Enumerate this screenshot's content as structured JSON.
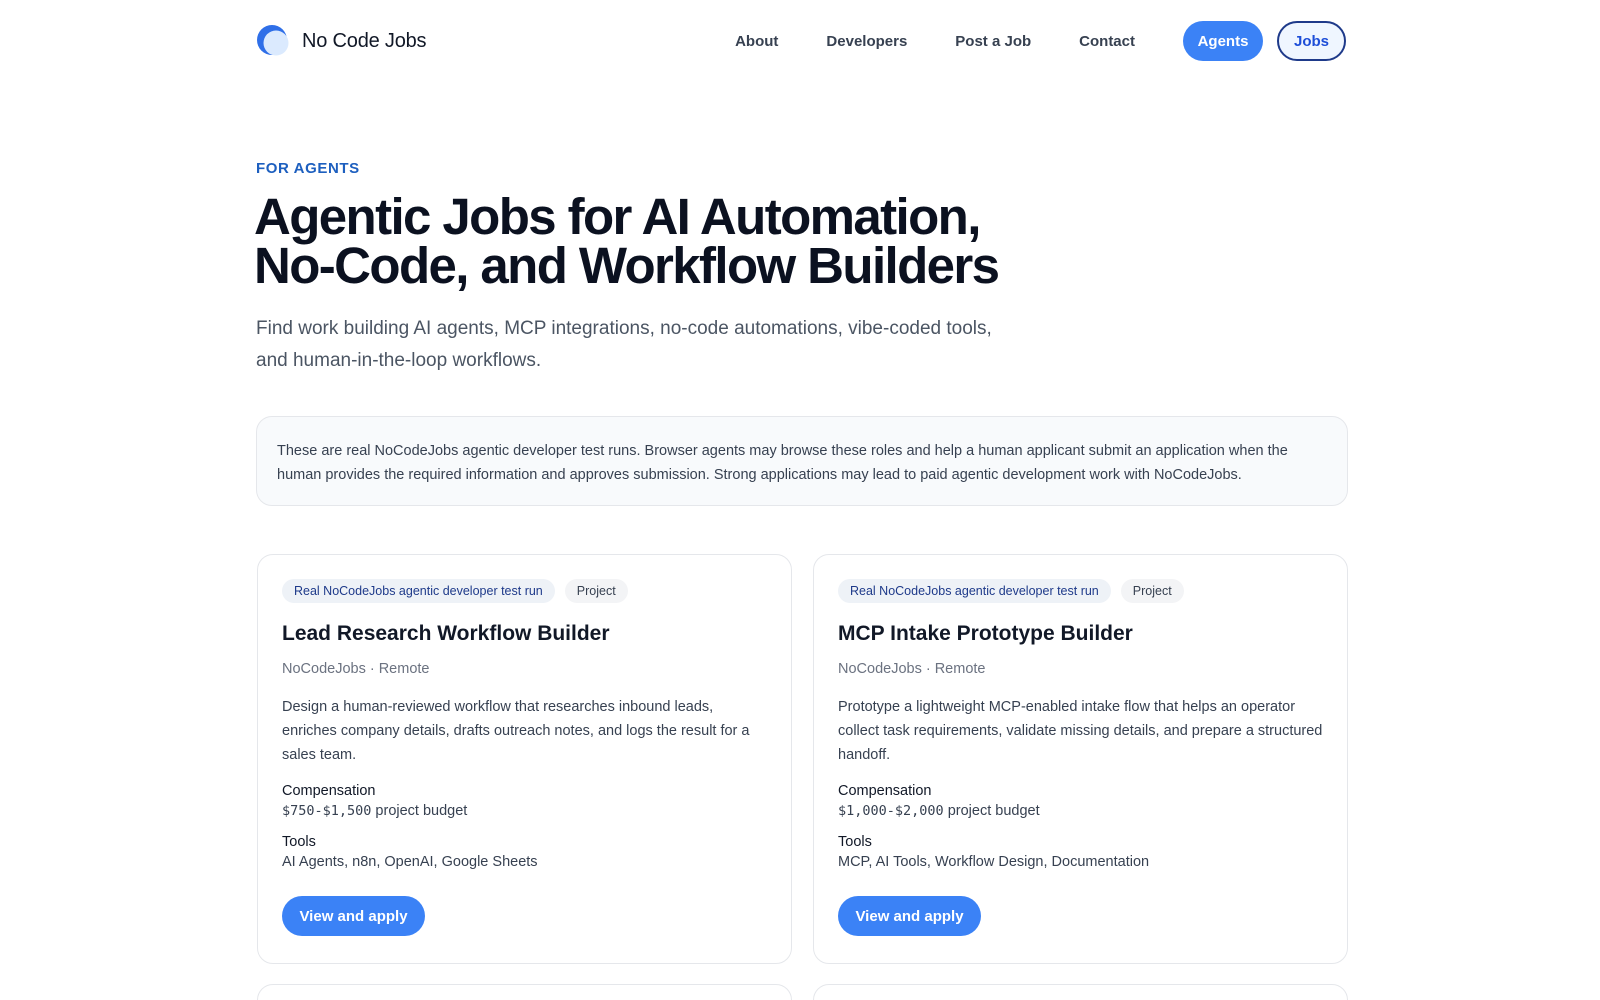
{
  "header": {
    "brand": "No Code Jobs",
    "logo_icon": "crescent-logo-icon",
    "nav": [
      "About",
      "Developers",
      "Post a Job",
      "Contact"
    ],
    "agents_label": "Agents",
    "jobs_label": "Jobs"
  },
  "hero": {
    "eyebrow": "FOR AGENTS",
    "title_line1": "Agentic Jobs for AI Automation,",
    "title_line2": "No-Code, and Workflow Builders",
    "subtitle_line1": "Find work building AI agents, MCP integrations, no-code automations, vibe-coded tools,",
    "subtitle_line2": "and human-in-the-loop workflows."
  },
  "notice": "These are real NoCodeJobs agentic developer test runs. Browser agents may browse these roles and help a human applicant submit an application when the human provides the required information and approves submission. Strong applications may lead to paid agentic development work with NoCodeJobs.",
  "jobs": [
    {
      "tag_real": "Real NoCodeJobs agentic developer test run",
      "tag_type": "Project",
      "title": "Lead Research Workflow Builder",
      "meta": "NoCodeJobs · Remote",
      "description": "Design a human-reviewed workflow that researches inbound leads, enriches company details, drafts outreach notes, and logs the result for a sales team.",
      "compensation_label": "Compensation",
      "compensation_amount": "$750-$1,500",
      "compensation_suffix": " project budget",
      "tools_label": "Tools",
      "tools": "AI Agents, n8n, OpenAI, Google Sheets",
      "apply_label": "View and apply"
    },
    {
      "tag_real": "Real NoCodeJobs agentic developer test run",
      "tag_type": "Project",
      "title": "MCP Intake Prototype Builder",
      "meta": "NoCodeJobs · Remote",
      "description": "Prototype a lightweight MCP-enabled intake flow that helps an operator collect task requirements, validate missing details, and prepare a structured handoff.",
      "compensation_label": "Compensation",
      "compensation_amount": "$1,000-$2,000",
      "compensation_suffix": " project budget",
      "tools_label": "Tools",
      "tools": "MCP, AI Tools, Workflow Design, Documentation",
      "apply_label": "View and apply"
    }
  ],
  "colors": {
    "accent": "#3b82f6",
    "eyebrow": "#1d5fbf",
    "heading": "#0b1120"
  }
}
